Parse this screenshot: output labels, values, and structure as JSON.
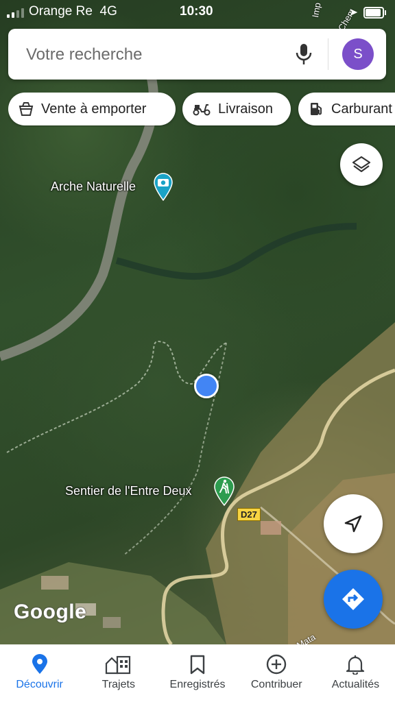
{
  "status_bar": {
    "carrier": "Orange Re",
    "network": "4G",
    "time": "10:30"
  },
  "search": {
    "placeholder": "Votre recherche",
    "avatar_letter": "S",
    "avatar_color": "#7b4fc9"
  },
  "chips": [
    {
      "label": "Vente à emporter",
      "icon": "takeout-icon"
    },
    {
      "label": "Livraison",
      "icon": "scooter-icon"
    },
    {
      "label": "Carburant",
      "icon": "fuel-icon"
    }
  ],
  "map": {
    "pois": [
      {
        "label": "Arche Naturelle",
        "icon": "camera-icon",
        "color": "#1aa3c7"
      },
      {
        "label": "Sentier de l'Entre Deux",
        "icon": "hiker-icon",
        "color": "#2d9c4f"
      }
    ],
    "road_label": "D27",
    "street_labels": [
      "Imp",
      "Chem",
      "Mata"
    ],
    "logo": "Google"
  },
  "bottom_nav": [
    {
      "label": "Découvrir",
      "icon": "pin-icon",
      "active": true
    },
    {
      "label": "Trajets",
      "icon": "commute-icon",
      "active": false
    },
    {
      "label": "Enregistrés",
      "icon": "bookmark-icon",
      "active": false
    },
    {
      "label": "Contribuer",
      "icon": "add-circle-icon",
      "active": false
    },
    {
      "label": "Actualités",
      "icon": "bell-icon",
      "active": false
    }
  ],
  "colors": {
    "accent": "#1a73e8",
    "road": "#f7d443"
  }
}
